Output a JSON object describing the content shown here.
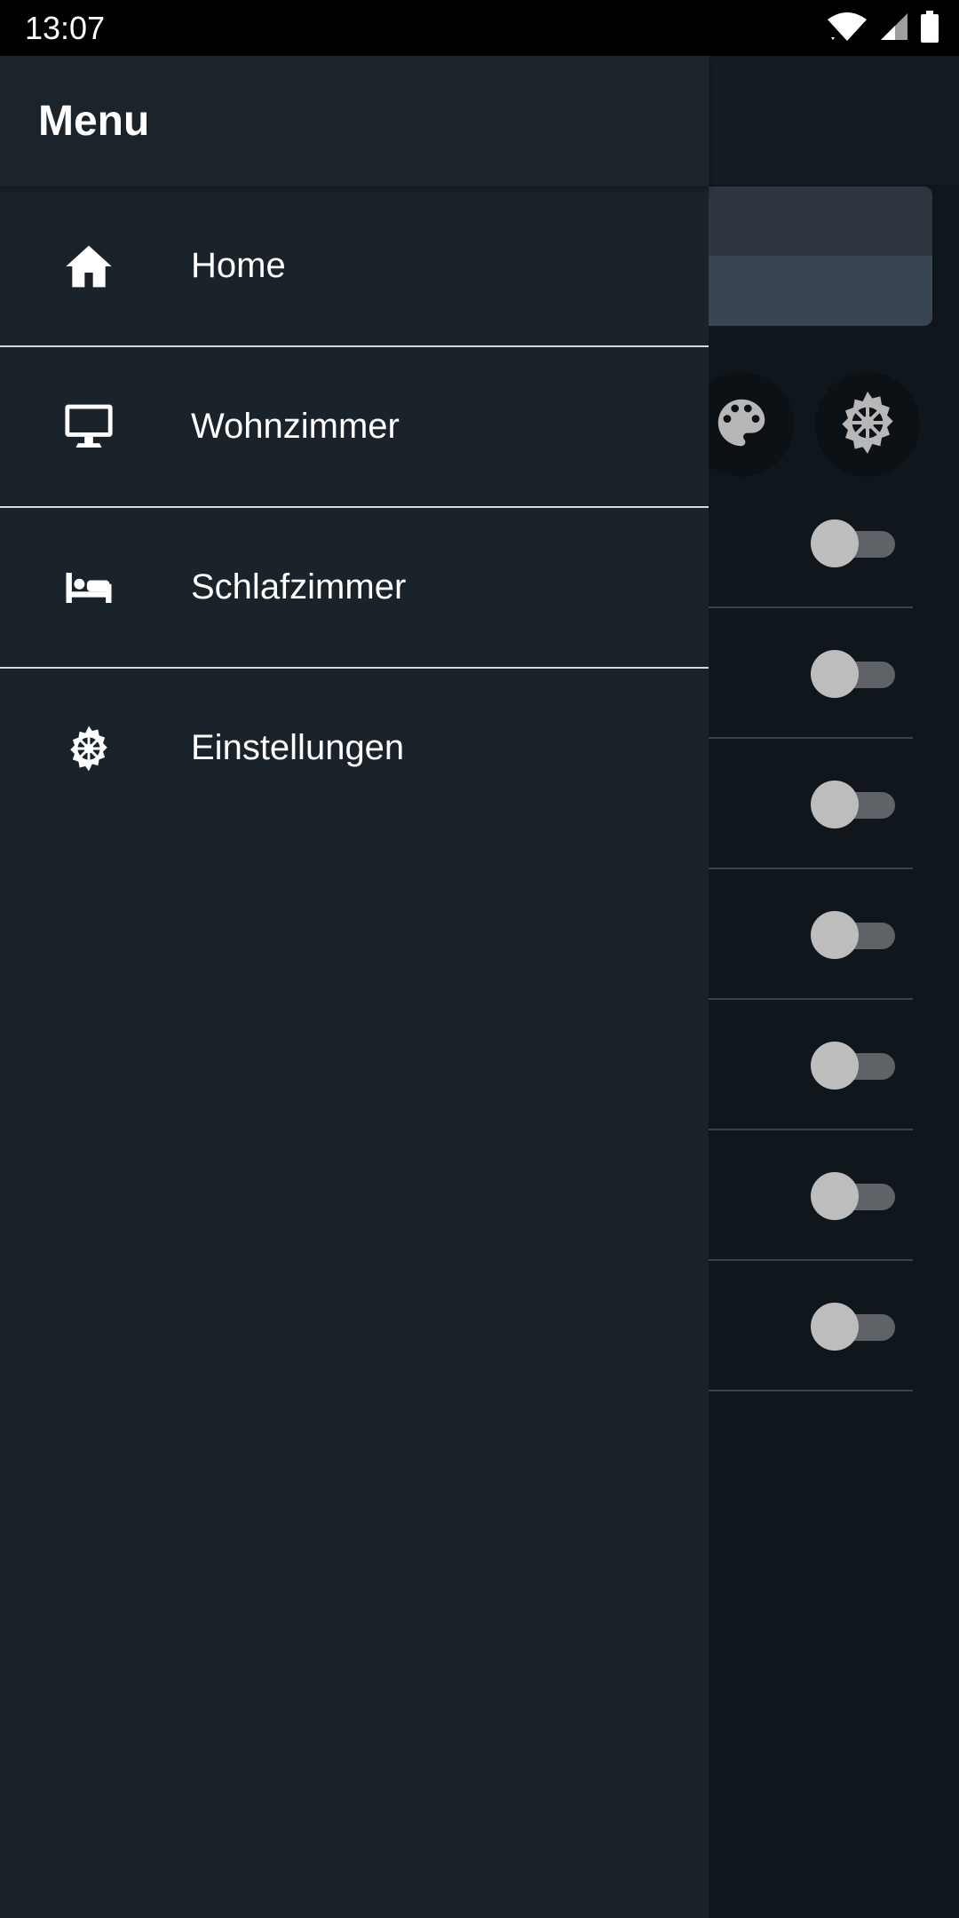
{
  "status_bar": {
    "time": "13:07",
    "icons": [
      "wifi-icon",
      "cell-signal-icon",
      "battery-icon"
    ]
  },
  "drawer": {
    "title": "Menu",
    "items": [
      {
        "label": "Home",
        "icon": "home-icon"
      },
      {
        "label": "Wohnzimmer",
        "icon": "monitor-icon"
      },
      {
        "label": "Schlafzimmer",
        "icon": "bed-icon"
      },
      {
        "label": "Einstellungen",
        "icon": "gear-icon"
      }
    ]
  },
  "background": {
    "action_icons": [
      "palette-icon",
      "gear-icon"
    ],
    "toggles": [
      false,
      false,
      false,
      false,
      false,
      false,
      false
    ]
  },
  "colors": {
    "drawer_bg": "#1a2329",
    "scrim_bg": "#10171c",
    "text": "#ffffff",
    "divider": "#d7dadc"
  }
}
